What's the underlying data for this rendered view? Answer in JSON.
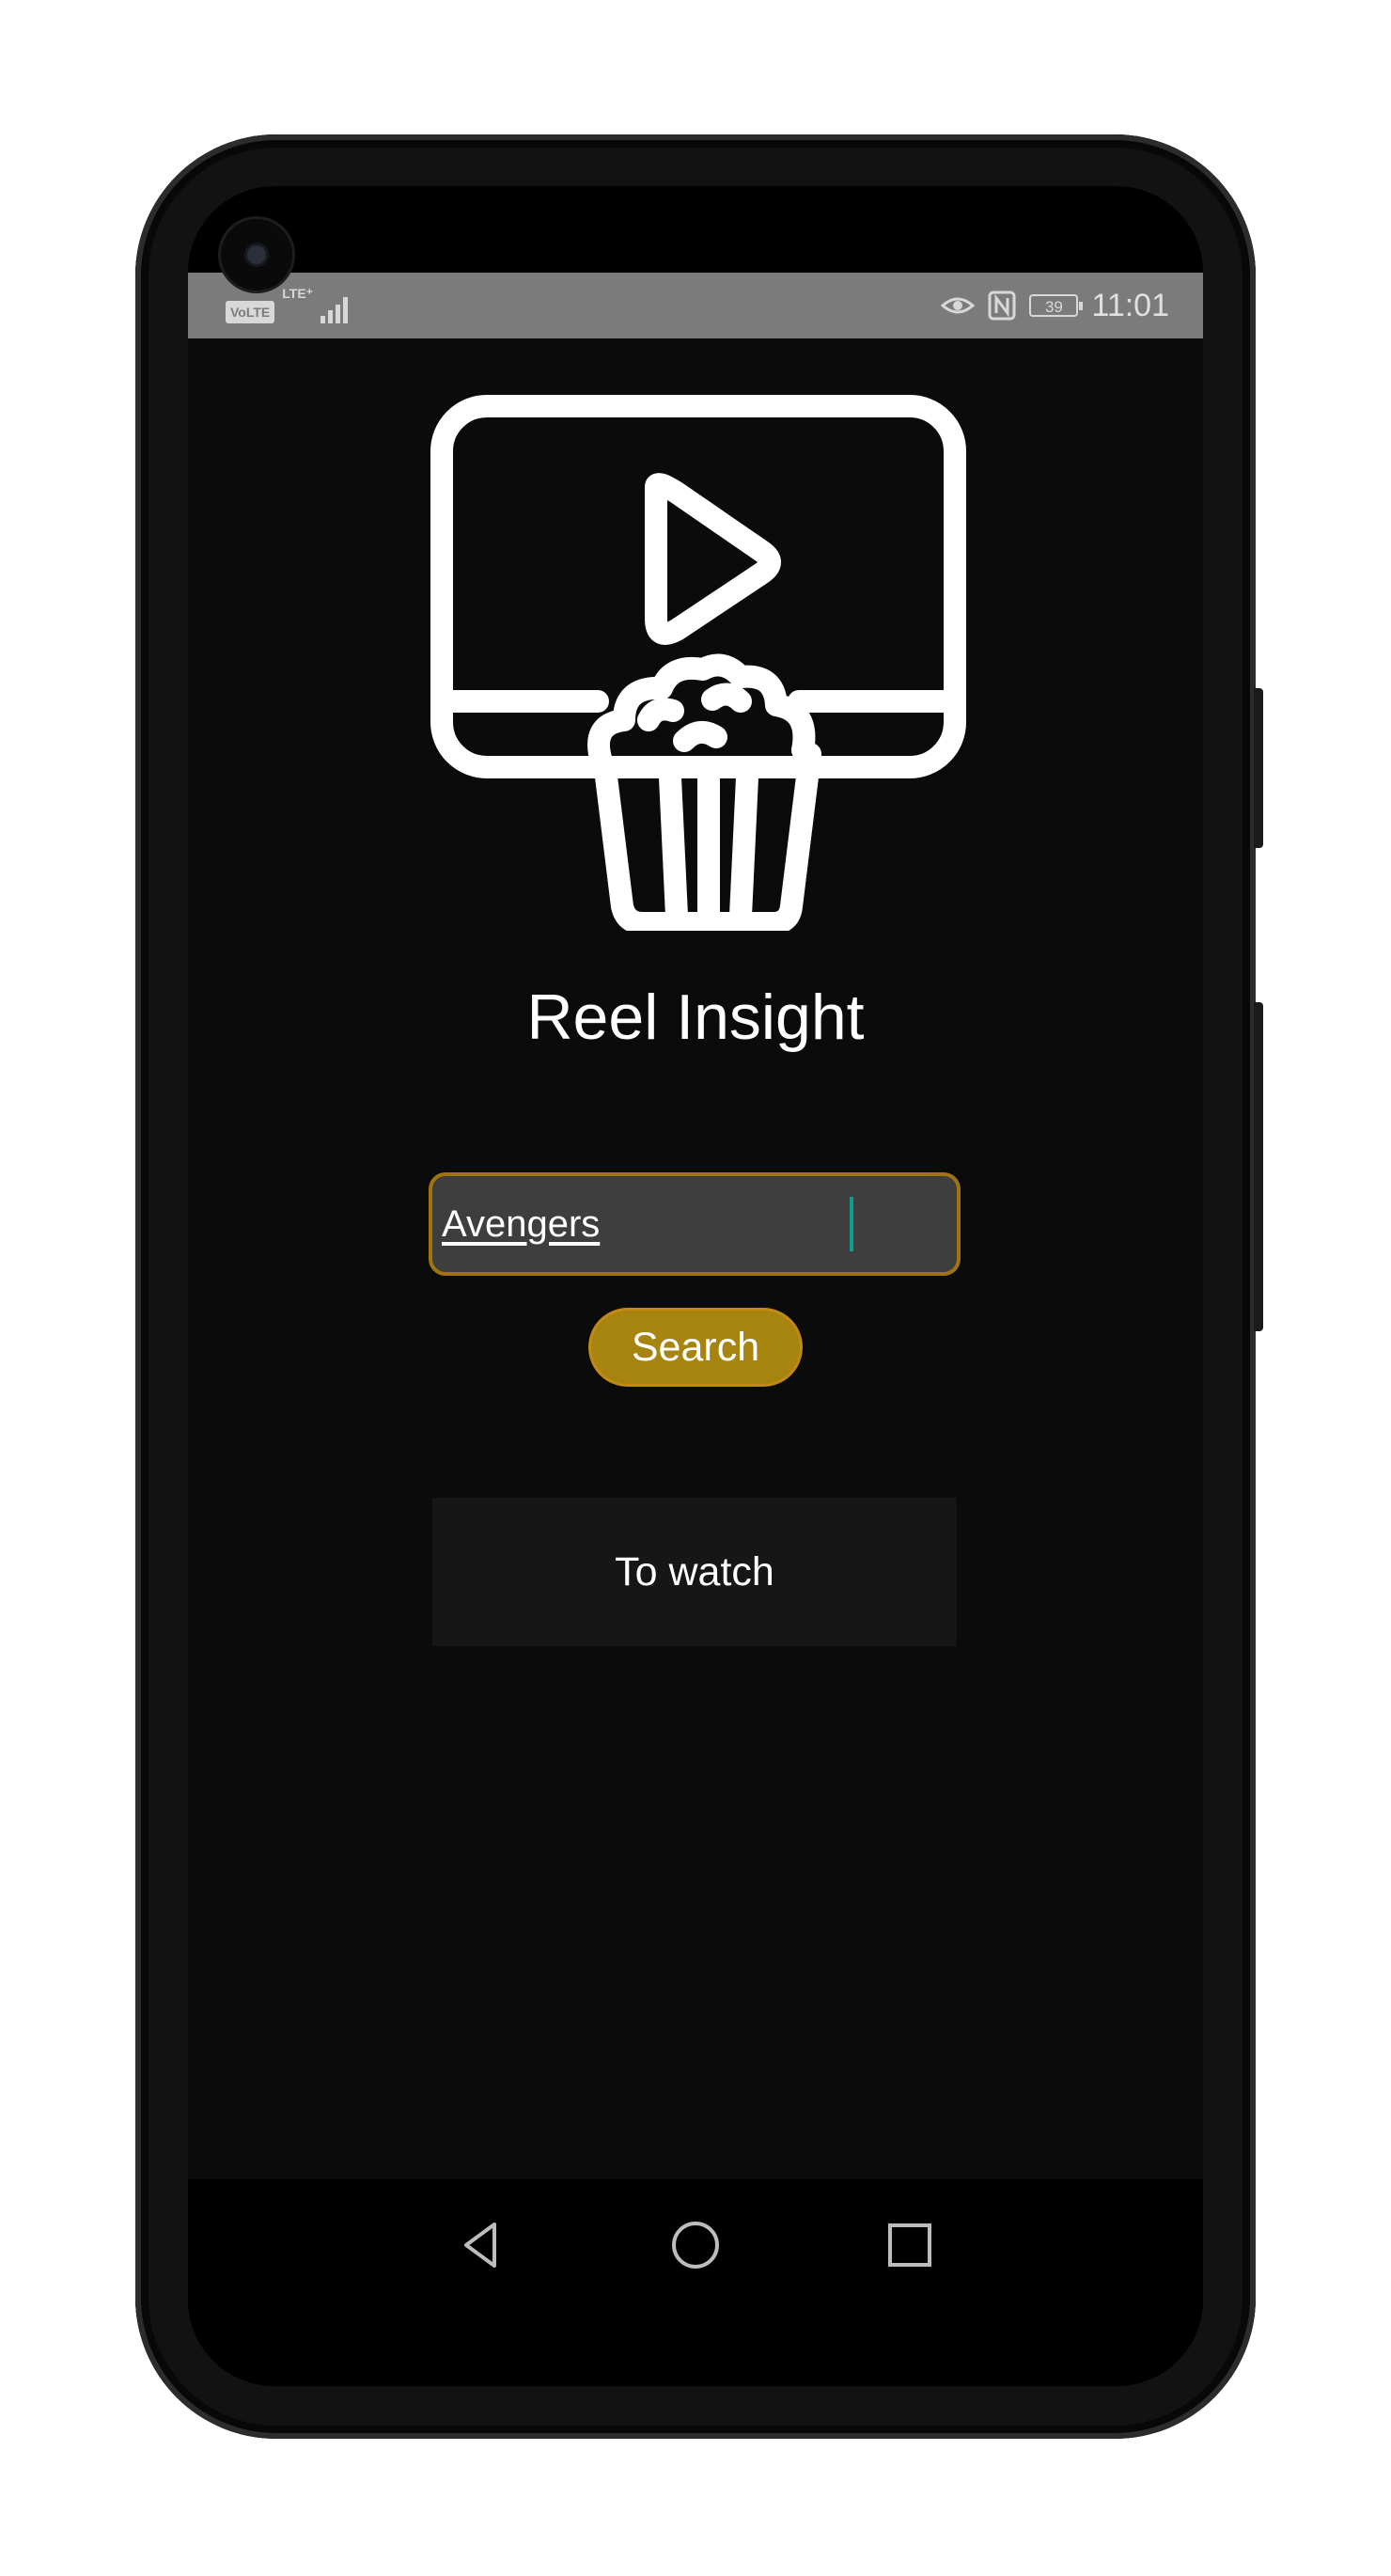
{
  "status_bar": {
    "volte": "VoLTE",
    "network": "LTE⁺",
    "battery": "39",
    "time": "11:01",
    "icons": [
      "eye-comfort-icon",
      "nfc-icon",
      "battery-icon",
      "signal-icon"
    ]
  },
  "app": {
    "title": "Reel Insight",
    "logo_icon": "tv-popcorn-logo-icon",
    "search": {
      "value": "Avengers",
      "placeholder": ""
    },
    "search_button": "Search",
    "to_watch_button": "To watch"
  },
  "nav_bar": {
    "icons": [
      "back-icon",
      "home-icon",
      "recents-icon"
    ]
  },
  "colors": {
    "background": "#0b0b0b",
    "status_bar": "#7b7b7b",
    "input_background": "#3e3e3e",
    "input_border": "#a27410",
    "accent_button": "#a6840f",
    "secondary_button": "#161616",
    "caret": "#0f9b8e"
  }
}
